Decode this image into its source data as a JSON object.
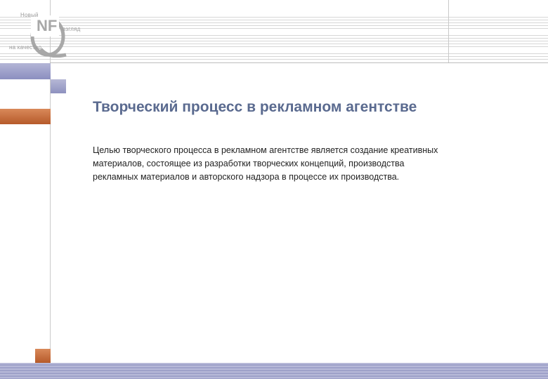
{
  "logo": {
    "top_word": "Новый",
    "right_word": "взгляд",
    "bottom_word": "на качество",
    "mark_letters": "NF"
  },
  "slide": {
    "title": "Творческий процесс в рекламном агентстве",
    "paragraph": "Целью творческого процесса в рекламном агентстве является создание креативных материалов, состоящее из разработки творческих концепций, производства рекламных материалов и авторского надзора в процессе их производства."
  },
  "colors": {
    "accent_purple": "#8c8fc0",
    "accent_orange": "#b65a2a",
    "title_blue": "#5a6a8f"
  }
}
